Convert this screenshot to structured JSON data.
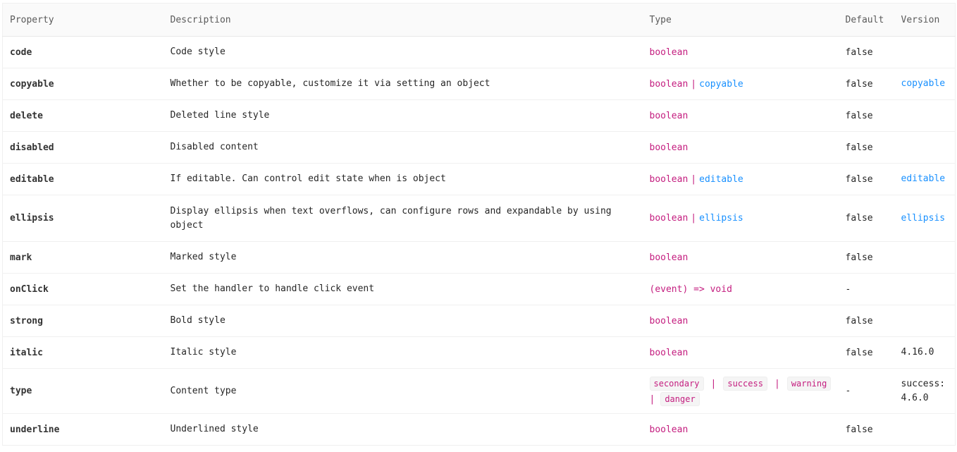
{
  "headers": {
    "property": "Property",
    "description": "Description",
    "type": "Type",
    "default": "Default",
    "version": "Version"
  },
  "rows": [
    {
      "property": "code",
      "description": "Code style",
      "type": [
        "boolean"
      ],
      "default": "false",
      "version": ""
    },
    {
      "property": "copyable",
      "description": "Whether to be copyable, customize it via setting an object",
      "type": [
        "boolean",
        "|",
        "copyable"
      ],
      "default": "false",
      "version": "copyable"
    },
    {
      "property": "delete",
      "description": "Deleted line style",
      "type": [
        "boolean"
      ],
      "default": "false",
      "version": ""
    },
    {
      "property": "disabled",
      "description": "Disabled content",
      "type": [
        "boolean"
      ],
      "default": "false",
      "version": ""
    },
    {
      "property": "editable",
      "description": "If editable. Can control edit state when is object",
      "type": [
        "boolean",
        "|",
        "editable"
      ],
      "default": "false",
      "version": "editable"
    },
    {
      "property": "ellipsis",
      "description": "Display ellipsis when text overflows, can configure rows and expandable by using object",
      "type": [
        "boolean",
        "|",
        "ellipsis"
      ],
      "default": "false",
      "version": "ellipsis"
    },
    {
      "property": "mark",
      "description": "Marked style",
      "type": [
        "boolean"
      ],
      "default": "false",
      "version": ""
    },
    {
      "property": "onClick",
      "description": "Set the handler to handle click event",
      "type": [
        "(event) => void"
      ],
      "default": "-",
      "version": ""
    },
    {
      "property": "strong",
      "description": "Bold style",
      "type": [
        "boolean"
      ],
      "default": "false",
      "version": ""
    },
    {
      "property": "italic",
      "description": "Italic style",
      "type": [
        "boolean"
      ],
      "default": "false",
      "version": "4.16.0"
    },
    {
      "property": "type",
      "description": "Content type",
      "type": [
        "secondary",
        "|",
        "success",
        "|",
        "warning",
        "|",
        "danger"
      ],
      "default": "-",
      "version": "success: 4.6.0"
    },
    {
      "property": "underline",
      "description": "Underlined style",
      "type": [
        "boolean"
      ],
      "default": "false",
      "version": ""
    }
  ],
  "colors": {
    "type_text": "#c41d7f",
    "link": "#1890ff",
    "header_bg": "#fafafa",
    "border": "#f0f0f0"
  }
}
